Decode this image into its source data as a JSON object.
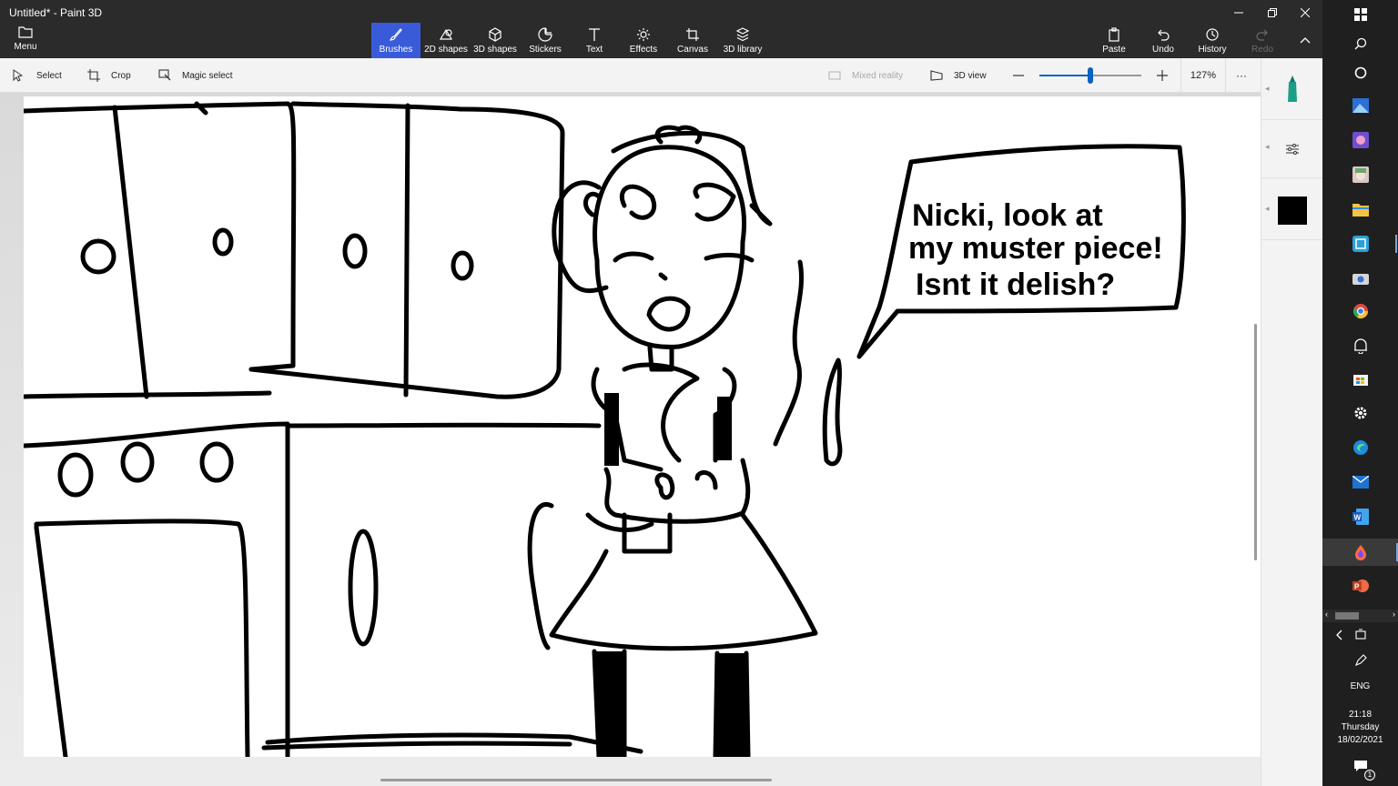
{
  "window": {
    "title": "Untitled* - Paint 3D",
    "controls": [
      "minimize",
      "restore",
      "close"
    ]
  },
  "menu": {
    "label": "Menu"
  },
  "toolbar": {
    "tools": [
      {
        "label": "Brushes",
        "icon": "brush-icon",
        "active": true
      },
      {
        "label": "2D shapes",
        "icon": "2d-shapes-icon"
      },
      {
        "label": "3D shapes",
        "icon": "3d-shapes-icon"
      },
      {
        "label": "Stickers",
        "icon": "stickers-icon"
      },
      {
        "label": "Text",
        "icon": "text-icon"
      },
      {
        "label": "Effects",
        "icon": "effects-icon"
      },
      {
        "label": "Canvas",
        "icon": "canvas-icon"
      },
      {
        "label": "3D library",
        "icon": "3d-library-icon"
      }
    ],
    "right": [
      {
        "label": "Paste",
        "icon": "paste-icon"
      },
      {
        "label": "Undo",
        "icon": "undo-icon"
      },
      {
        "label": "History",
        "icon": "history-icon"
      },
      {
        "label": "Redo",
        "icon": "redo-icon",
        "disabled": true
      }
    ]
  },
  "subtoolbar": {
    "select": "Select",
    "crop": "Crop",
    "magic_select": "Magic select",
    "mixed_reality": "Mixed reality",
    "view_3d": "3D view",
    "zoom": "127%",
    "zoom_level": 0.5,
    "more": "···"
  },
  "canvas": {
    "speech_line1": "Nicki, look at",
    "speech_line2": "my muster piece!",
    "speech_line3": "Isnt it delish?"
  },
  "sidepanel": {
    "selected_color": "#000000",
    "tool_color": "#1a9f86"
  },
  "taskbar": {
    "language": "ENG",
    "time": "21:18",
    "day": "Thursday",
    "date": "18/02/2021",
    "notifications": "1"
  }
}
